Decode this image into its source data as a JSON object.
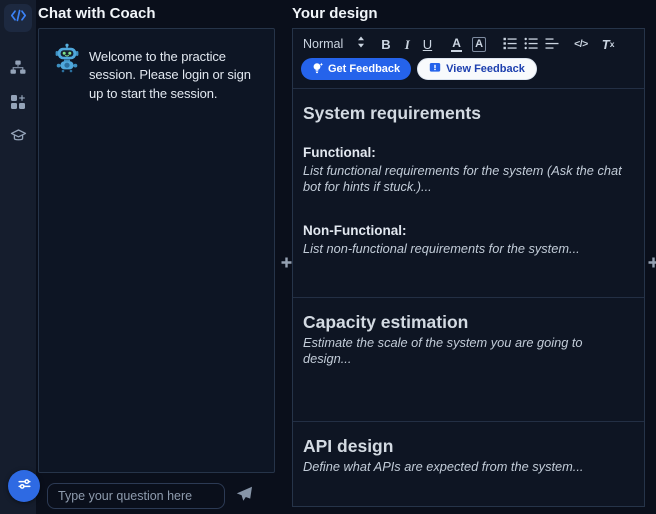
{
  "colors": {
    "accent_blue": "#2563eb",
    "page_bg": "#0a0f1b",
    "panel_bg": "#0d1524",
    "panel_border": "#263449"
  },
  "sidebar": {
    "logo_icon": "code-brackets-icon",
    "items": [
      {
        "icon": "sitemap-icon"
      },
      {
        "icon": "components-icon"
      },
      {
        "icon": "graduation-cap-icon"
      }
    ],
    "floating_button_icon": "sliders-icon"
  },
  "chat": {
    "title": "Chat with Coach",
    "bot_avatar": "robot-icon",
    "message": "Welcome to the practice session. Please login or sign up to start the session.",
    "input_placeholder": "Type your question here",
    "send_icon": "paper-plane-icon"
  },
  "design": {
    "title": "Your design",
    "toolbar": {
      "style_label": "Normal",
      "bold": "B",
      "italic": "I",
      "underline": "U",
      "text_color": "A",
      "highlight": "A",
      "code": "</>",
      "clear_t": "T",
      "clear_x": "x",
      "icon_buttons": [
        "ordered-list-icon",
        "bullet-list-icon",
        "align-icon"
      ]
    },
    "actions": {
      "get_feedback": "Get Feedback",
      "view_feedback": "View Feedback"
    },
    "sections": [
      {
        "heading": "System requirements",
        "blocks": [
          {
            "label": "Functional:",
            "hint": "List functional requirements for the system (Ask the chat bot for hints if stuck.)..."
          },
          {
            "label": "Non-Functional:",
            "hint": "List non-functional requirements for the system..."
          }
        ]
      },
      {
        "heading": "Capacity estimation",
        "hint": "Estimate the scale of the system you are going to design..."
      },
      {
        "heading": "API design",
        "hint": "Define what APIs are expected from the system..."
      }
    ]
  }
}
